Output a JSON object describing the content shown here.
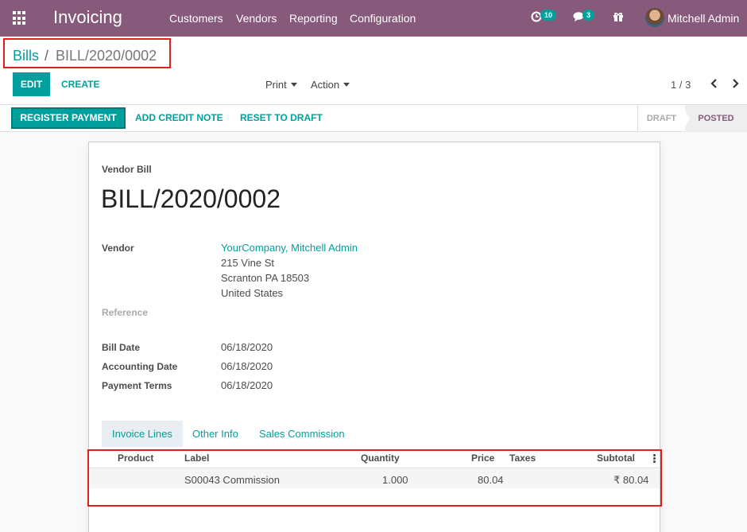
{
  "navbar": {
    "app_title": "Invoicing",
    "menus": [
      "Customers",
      "Vendors",
      "Reporting",
      "Configuration"
    ],
    "activity_count": "10",
    "message_count": "3",
    "user_name": "Mitchell Admin",
    "color": "#875a7b"
  },
  "breadcrumb": {
    "parent": "Bills",
    "separator": "/",
    "current": "BILL/2020/0002"
  },
  "control": {
    "edit_label": "EDIT",
    "create_label": "CREATE",
    "print_label": "Print",
    "action_label": "Action",
    "pager": "1 / 3"
  },
  "statusbar": {
    "register_payment": "REGISTER PAYMENT",
    "add_credit_note": "ADD CREDIT NOTE",
    "reset_to_draft": "RESET TO DRAFT",
    "stages": [
      "DRAFT",
      "POSTED"
    ],
    "active_stage": "POSTED"
  },
  "document": {
    "type_label": "Vendor Bill",
    "name": "BILL/2020/0002",
    "vendor_label": "Vendor",
    "vendor_name": "YourCompany, Mitchell Admin",
    "vendor_address": [
      "215 Vine St",
      "Scranton PA 18503",
      "United States"
    ],
    "reference_label": "Reference",
    "bill_date_label": "Bill Date",
    "bill_date": "06/18/2020",
    "accounting_date_label": "Accounting Date",
    "accounting_date": "06/18/2020",
    "payment_terms_label": "Payment Terms",
    "payment_terms": "06/18/2020"
  },
  "tabs": [
    "Invoice Lines",
    "Other Info",
    "Sales Commission"
  ],
  "lines": {
    "columns": [
      "Product",
      "Label",
      "Quantity",
      "Price",
      "Taxes",
      "Subtotal"
    ],
    "rows": [
      {
        "product": "",
        "label": "S00043 Commission",
        "quantity": "1.000",
        "price": "80.04",
        "taxes": "",
        "subtotal": "₹ 80.04"
      }
    ]
  },
  "colors": {
    "accent": "#00a09d",
    "highlight_box": "#e02020"
  }
}
